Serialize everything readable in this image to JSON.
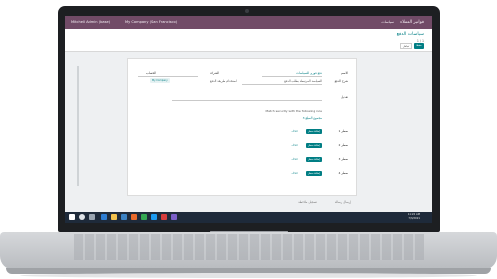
{
  "window": {
    "app_title": "فواتير العملاء",
    "user": "Mitchell Admin (base)",
    "company": "My Company (San Francisco)",
    "top_right": "سياسات"
  },
  "breadcrumb": {
    "title": "سياسات الدفع",
    "subtitle": "1 / 1",
    "save_label": "حفظ",
    "discard_label": "تجاهل"
  },
  "form": {
    "fields": [
      {
        "label": "الاسم",
        "value": "دفع فوري للسياسات"
      },
      {
        "label": "شرح الدفع",
        "value": "السياسة المرتبطة بطلب الدفع"
      },
      {
        "label": "الشركة",
        "value": "My Company"
      },
      {
        "label": "الحساب",
        "value": "تحديد تاريخ الاستحقاق"
      }
    ],
    "checkbox_label": "استخدام طريقة الدفع",
    "rule_text": "Match security with the following rule",
    "rule_tag": "3 مجموع المبلغ",
    "rule_link": "تعديل",
    "lines": [
      {
        "label": "سطر 1",
        "button": "إضافة سطر",
        "link": "حذف"
      },
      {
        "label": "سطر 2",
        "button": "إضافة سطر",
        "link": "حذف"
      },
      {
        "label": "سطر 3",
        "button": "إضافة سطر",
        "link": "حذف"
      },
      {
        "label": "سطر 4",
        "button": "إضافة سطر",
        "link": "حذف"
      }
    ]
  },
  "footer": {
    "left": "إرسال رسالة",
    "right": "تسجيل ملاحظة"
  },
  "taskbar": {
    "time": "11:22 AM",
    "date": "7/3/2021"
  },
  "colors": {
    "brand": "#714b67",
    "accent": "#017e84",
    "taskbar": "#1e2a3a"
  }
}
